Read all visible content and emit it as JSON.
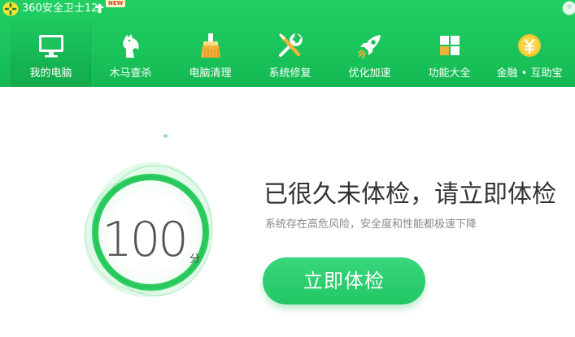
{
  "titlebar": {
    "app_title": "360安全卫士12",
    "new_badge": "NEW"
  },
  "nav": {
    "items": [
      {
        "label": "我的电脑",
        "icon": "monitor-icon",
        "active": true
      },
      {
        "label": "木马查杀",
        "icon": "horse-icon",
        "active": false
      },
      {
        "label": "电脑清理",
        "icon": "broom-icon",
        "active": false
      },
      {
        "label": "系统修复",
        "icon": "wrench-screwdriver-icon",
        "active": false
      },
      {
        "label": "优化加速",
        "icon": "rocket-icon",
        "active": false
      },
      {
        "label": "功能大全",
        "icon": "grid-icon",
        "active": false
      },
      {
        "label": "金融 • 互助宝",
        "icon": "yen-coin-icon",
        "active": false
      }
    ]
  },
  "main": {
    "score": "100",
    "score_unit": "分",
    "headline": "已很久未体检，请立即体检",
    "subtext": "系统存在高危风险，安全度和性能都极速下降",
    "check_button": "立即体检"
  },
  "colors": {
    "header_green": "#1ec55d",
    "accent_green": "#2bcf6e",
    "ring_green": "#3fcf6a"
  }
}
